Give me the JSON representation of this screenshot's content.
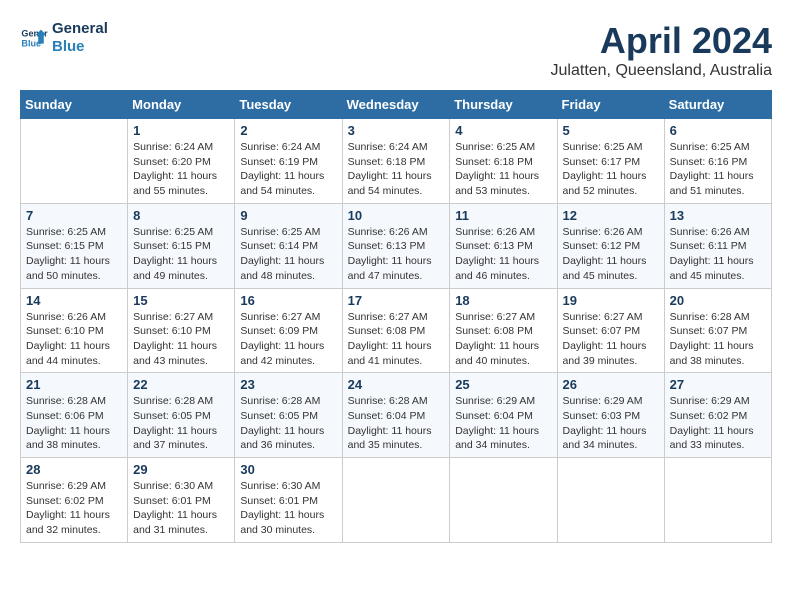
{
  "logo": {
    "text_general": "General",
    "text_blue": "Blue"
  },
  "header": {
    "month": "April 2024",
    "location": "Julatten, Queensland, Australia"
  },
  "weekdays": [
    "Sunday",
    "Monday",
    "Tuesday",
    "Wednesday",
    "Thursday",
    "Friday",
    "Saturday"
  ],
  "weeks": [
    [
      {
        "day": "",
        "info": ""
      },
      {
        "day": "1",
        "info": "Sunrise: 6:24 AM\nSunset: 6:20 PM\nDaylight: 11 hours\nand 55 minutes."
      },
      {
        "day": "2",
        "info": "Sunrise: 6:24 AM\nSunset: 6:19 PM\nDaylight: 11 hours\nand 54 minutes."
      },
      {
        "day": "3",
        "info": "Sunrise: 6:24 AM\nSunset: 6:18 PM\nDaylight: 11 hours\nand 54 minutes."
      },
      {
        "day": "4",
        "info": "Sunrise: 6:25 AM\nSunset: 6:18 PM\nDaylight: 11 hours\nand 53 minutes."
      },
      {
        "day": "5",
        "info": "Sunrise: 6:25 AM\nSunset: 6:17 PM\nDaylight: 11 hours\nand 52 minutes."
      },
      {
        "day": "6",
        "info": "Sunrise: 6:25 AM\nSunset: 6:16 PM\nDaylight: 11 hours\nand 51 minutes."
      }
    ],
    [
      {
        "day": "7",
        "info": "Sunrise: 6:25 AM\nSunset: 6:15 PM\nDaylight: 11 hours\nand 50 minutes."
      },
      {
        "day": "8",
        "info": "Sunrise: 6:25 AM\nSunset: 6:15 PM\nDaylight: 11 hours\nand 49 minutes."
      },
      {
        "day": "9",
        "info": "Sunrise: 6:25 AM\nSunset: 6:14 PM\nDaylight: 11 hours\nand 48 minutes."
      },
      {
        "day": "10",
        "info": "Sunrise: 6:26 AM\nSunset: 6:13 PM\nDaylight: 11 hours\nand 47 minutes."
      },
      {
        "day": "11",
        "info": "Sunrise: 6:26 AM\nSunset: 6:13 PM\nDaylight: 11 hours\nand 46 minutes."
      },
      {
        "day": "12",
        "info": "Sunrise: 6:26 AM\nSunset: 6:12 PM\nDaylight: 11 hours\nand 45 minutes."
      },
      {
        "day": "13",
        "info": "Sunrise: 6:26 AM\nSunset: 6:11 PM\nDaylight: 11 hours\nand 45 minutes."
      }
    ],
    [
      {
        "day": "14",
        "info": "Sunrise: 6:26 AM\nSunset: 6:10 PM\nDaylight: 11 hours\nand 44 minutes."
      },
      {
        "day": "15",
        "info": "Sunrise: 6:27 AM\nSunset: 6:10 PM\nDaylight: 11 hours\nand 43 minutes."
      },
      {
        "day": "16",
        "info": "Sunrise: 6:27 AM\nSunset: 6:09 PM\nDaylight: 11 hours\nand 42 minutes."
      },
      {
        "day": "17",
        "info": "Sunrise: 6:27 AM\nSunset: 6:08 PM\nDaylight: 11 hours\nand 41 minutes."
      },
      {
        "day": "18",
        "info": "Sunrise: 6:27 AM\nSunset: 6:08 PM\nDaylight: 11 hours\nand 40 minutes."
      },
      {
        "day": "19",
        "info": "Sunrise: 6:27 AM\nSunset: 6:07 PM\nDaylight: 11 hours\nand 39 minutes."
      },
      {
        "day": "20",
        "info": "Sunrise: 6:28 AM\nSunset: 6:07 PM\nDaylight: 11 hours\nand 38 minutes."
      }
    ],
    [
      {
        "day": "21",
        "info": "Sunrise: 6:28 AM\nSunset: 6:06 PM\nDaylight: 11 hours\nand 38 minutes."
      },
      {
        "day": "22",
        "info": "Sunrise: 6:28 AM\nSunset: 6:05 PM\nDaylight: 11 hours\nand 37 minutes."
      },
      {
        "day": "23",
        "info": "Sunrise: 6:28 AM\nSunset: 6:05 PM\nDaylight: 11 hours\nand 36 minutes."
      },
      {
        "day": "24",
        "info": "Sunrise: 6:28 AM\nSunset: 6:04 PM\nDaylight: 11 hours\nand 35 minutes."
      },
      {
        "day": "25",
        "info": "Sunrise: 6:29 AM\nSunset: 6:04 PM\nDaylight: 11 hours\nand 34 minutes."
      },
      {
        "day": "26",
        "info": "Sunrise: 6:29 AM\nSunset: 6:03 PM\nDaylight: 11 hours\nand 34 minutes."
      },
      {
        "day": "27",
        "info": "Sunrise: 6:29 AM\nSunset: 6:02 PM\nDaylight: 11 hours\nand 33 minutes."
      }
    ],
    [
      {
        "day": "28",
        "info": "Sunrise: 6:29 AM\nSunset: 6:02 PM\nDaylight: 11 hours\nand 32 minutes."
      },
      {
        "day": "29",
        "info": "Sunrise: 6:30 AM\nSunset: 6:01 PM\nDaylight: 11 hours\nand 31 minutes."
      },
      {
        "day": "30",
        "info": "Sunrise: 6:30 AM\nSunset: 6:01 PM\nDaylight: 11 hours\nand 30 minutes."
      },
      {
        "day": "",
        "info": ""
      },
      {
        "day": "",
        "info": ""
      },
      {
        "day": "",
        "info": ""
      },
      {
        "day": "",
        "info": ""
      }
    ]
  ]
}
